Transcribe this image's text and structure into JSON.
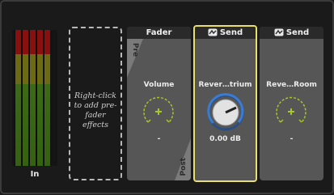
{
  "input_meter": {
    "label": "In",
    "level": 0.85
  },
  "pre_fader_drop": {
    "text": "Right-click to add pre-fader effects"
  },
  "strips": [
    {
      "header": "Fader",
      "header_icon": "none",
      "param_label": "Volume",
      "value": "-",
      "pre_tab": "Pre",
      "post_tab": "Post",
      "selected": false
    },
    {
      "header": "Send",
      "header_icon": "send-icon",
      "param_label": "Rever…trium",
      "value": "0.00 dB",
      "selected": true
    },
    {
      "header": "Send",
      "header_icon": "send-icon",
      "param_label": "Reve…Room",
      "value": "-",
      "selected": false
    }
  ],
  "colors": {
    "selection": "#e8e06a",
    "knob_ring_empty": "#a8c626",
    "knob_ring_active": "#3a7bd5",
    "strip_bg": "#565656",
    "header_bg": "#2a2a2a"
  }
}
